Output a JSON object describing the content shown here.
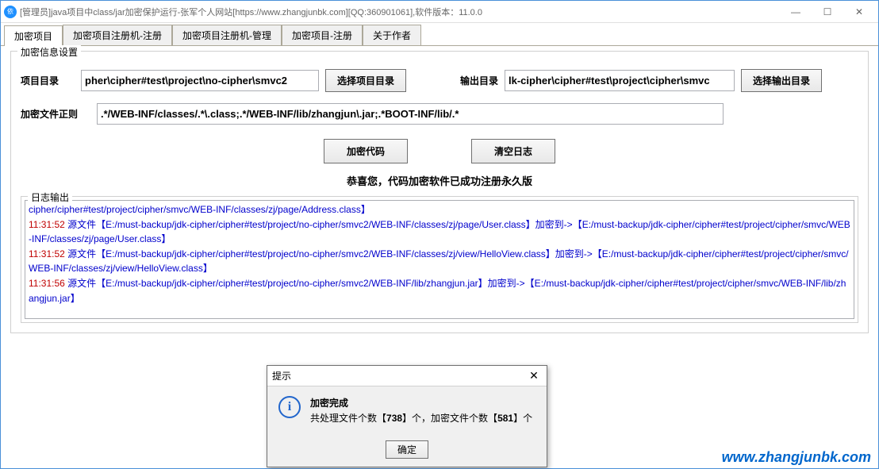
{
  "window": {
    "title": "[管理员]java项目中class/jar加密保护运行-张军个人网站[https://www.zhangjunbk.com][QQ:360901061],软件版本：11.0.0"
  },
  "tabs": [
    {
      "label": "加密项目",
      "active": true
    },
    {
      "label": "加密项目注册机-注册",
      "active": false
    },
    {
      "label": "加密项目注册机-管理",
      "active": false
    },
    {
      "label": "加密项目-注册",
      "active": false
    },
    {
      "label": "关于作者",
      "active": false
    }
  ],
  "form": {
    "fieldset_legend": "加密信息设置",
    "project_dir_label": "项目目录",
    "project_dir_value": "pher\\cipher#test\\project\\no-cipher\\smvc2",
    "choose_project_btn": "选择项目目录",
    "output_dir_label": "输出目录",
    "output_dir_value": "lk-cipher\\cipher#test\\project\\cipher\\smvc",
    "choose_output_btn": "选择输出目录",
    "regex_label": "加密文件正则",
    "regex_value": ".*/WEB-INF/classes/.*\\.class;.*/WEB-INF/lib/zhangjun\\.jar;.*BOOT-INF/lib/.*",
    "encrypt_btn": "加密代码",
    "clear_btn": "清空日志",
    "congrats": "恭喜您，代码加密软件已成功注册永久版"
  },
  "log": {
    "legend": "日志输出",
    "lines": [
      {
        "ts": "",
        "msg": "cipher/cipher#test/project/cipher/smvc/WEB-INF/classes/zj/page/Address.class】"
      },
      {
        "ts": "11:31:52",
        "msg": " 源文件【E:/must-backup/jdk-cipher/cipher#test/project/no-cipher/smvc2/WEB-INF/classes/zj/page/User.class】加密到->【E:/must-backup/jdk-cipher/cipher#test/project/cipher/smvc/WEB-INF/classes/zj/page/User.class】"
      },
      {
        "ts": "11:31:52",
        "msg": " 源文件【E:/must-backup/jdk-cipher/cipher#test/project/no-cipher/smvc2/WEB-INF/classes/zj/view/HelloView.class】加密到->【E:/must-backup/jdk-cipher/cipher#test/project/cipher/smvc/WEB-INF/classes/zj/view/HelloView.class】"
      },
      {
        "ts": "11:31:56",
        "msg": " 源文件【E:/must-backup/jdk-cipher/cipher#test/project/no-cipher/smvc2/WEB-INF/lib/zhangjun.jar】加密到->【E:/must-backup/jdk-cipher/cipher#test/project/cipher/smvc/WEB-INF/lib/zhangjun.jar】"
      }
    ]
  },
  "dialog": {
    "title": "提示",
    "heading": "加密完成",
    "body_prefix": "共处理文件个数【",
    "count1": "738",
    "body_mid": "】个，加密文件个数【",
    "count2": "581",
    "body_suffix": "】个",
    "ok": "确定"
  },
  "watermark": "www.zhangjunbk.com"
}
